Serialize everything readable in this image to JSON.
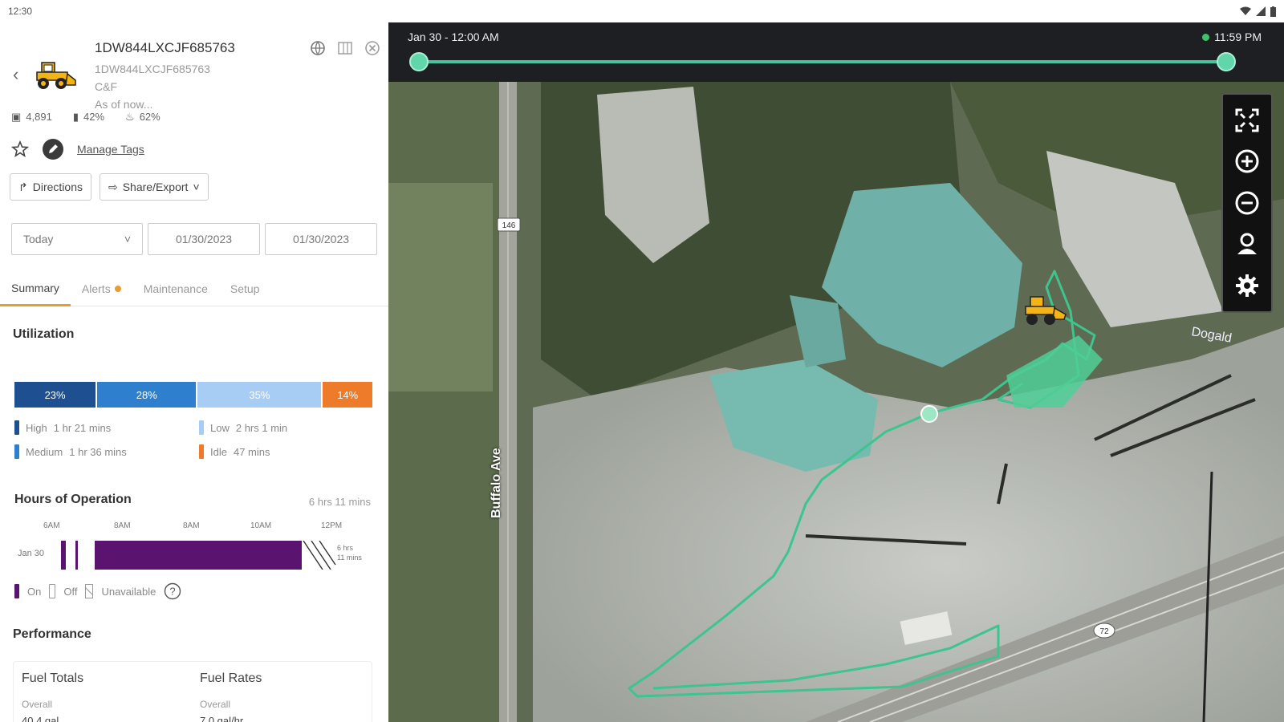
{
  "status_bar": {
    "time": "12:30"
  },
  "asset": {
    "title": "1DW844LXCJF685763",
    "serial": "1DW844LXCJF685763",
    "dealer": "C&F",
    "as_of": "As of now..."
  },
  "stats": {
    "hours": "4,891",
    "fuel": "42%",
    "def": "62%"
  },
  "actions": {
    "manage_tags": "Manage Tags",
    "directions": "Directions",
    "share_export": "Share/Export"
  },
  "date_range": {
    "period": "Today",
    "start": "01/30/2023",
    "end": "01/30/2023"
  },
  "tabs": [
    {
      "label": "Summary",
      "active": true
    },
    {
      "label": "Alerts",
      "active": false,
      "has_alert": true
    },
    {
      "label": "Maintenance",
      "active": false
    },
    {
      "label": "Setup",
      "active": false
    }
  ],
  "utilization": {
    "title": "Utilization",
    "segments": [
      {
        "label": "23%",
        "value": 0.23,
        "color": "#1d4f91"
      },
      {
        "label": "28%",
        "value": 0.28,
        "color": "#2e7fcd"
      },
      {
        "label": "35%",
        "value": 0.35,
        "color": "#a8cdf4"
      },
      {
        "label": "14%",
        "value": 0.14,
        "color": "#ed7b2a"
      }
    ],
    "legend": [
      {
        "name": "High",
        "value": "1 hr 21 mins",
        "color": "#1d4f91"
      },
      {
        "name": "Low",
        "value": "2 hrs 1 min",
        "color": "#a8cdf4"
      },
      {
        "name": "Medium",
        "value": "1 hr 36 mins",
        "color": "#2e7fcd"
      },
      {
        "name": "Idle",
        "value": "47 mins",
        "color": "#ed7b2a"
      }
    ]
  },
  "hours_of_operation": {
    "title": "Hours of Operation",
    "total": "6 hrs 11 mins",
    "ticks": [
      "6AM",
      "8AM",
      "8AM",
      "10AM",
      "12PM"
    ],
    "day": "Jan 30",
    "summary": "6 hrs 11 mins",
    "legend": {
      "on": "On",
      "off": "Off",
      "unavailable": "Unavailable"
    },
    "on_color": "#5b1370"
  },
  "performance": {
    "title": "Performance",
    "cards": [
      {
        "title": "Fuel Totals",
        "sub": "Overall",
        "value": "40.4 gal"
      },
      {
        "title": "Fuel Rates",
        "sub": "Overall",
        "value": "7.0 gal/hr"
      }
    ]
  },
  "timeline": {
    "start": "Jan 30 - 12:00 AM",
    "end": "11:59 PM"
  },
  "map": {
    "labels": {
      "avenue": "Buffalo Ave",
      "route_shield": "146",
      "highway_shield": "72",
      "street": "Dogald"
    },
    "controls": [
      "fullscreen-icon",
      "zoom-in-icon",
      "zoom-out-icon",
      "person-icon",
      "gear-icon"
    ],
    "track_color": "#3ec48e"
  }
}
